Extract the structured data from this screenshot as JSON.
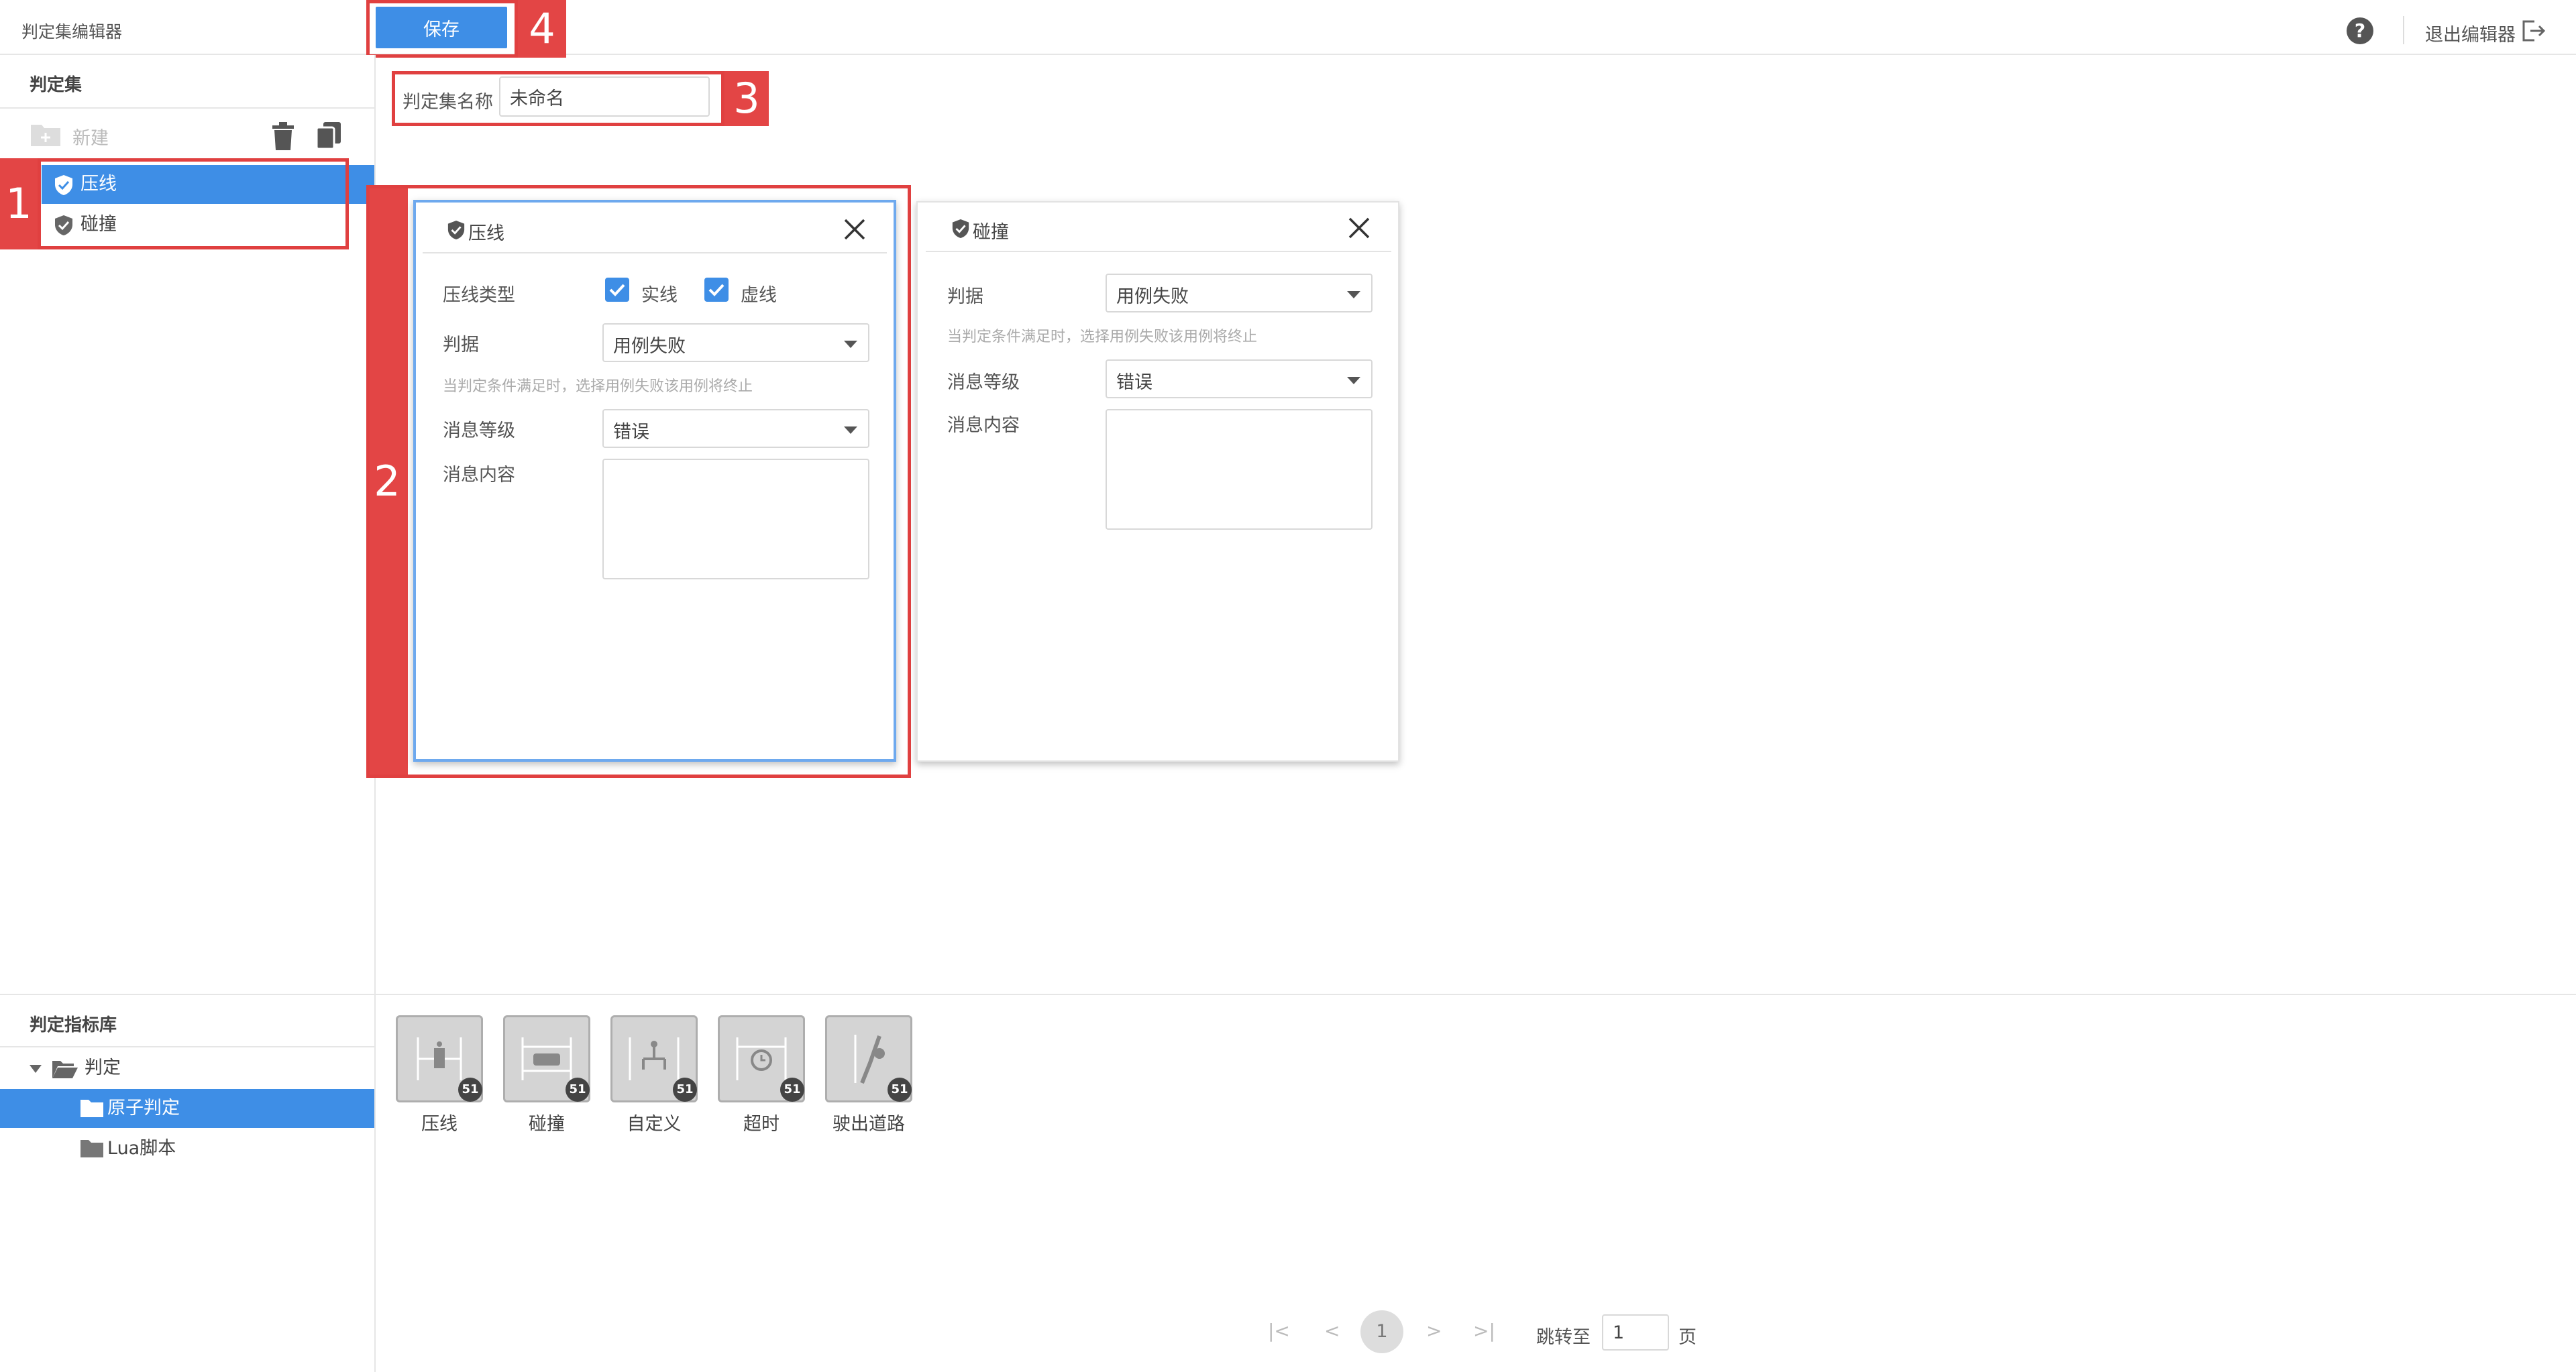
{
  "app": {
    "title": "判定集编辑器",
    "save_label": "保存",
    "help_icon": "?",
    "exit_label": "退出编辑器",
    "accent_color": "#3e8ee6",
    "marker_color": "#e34545"
  },
  "sidebar": {
    "section_title": "判定集",
    "new_label": "新建",
    "items": [
      {
        "label": "压线",
        "selected": true
      },
      {
        "label": "碰撞",
        "selected": false
      }
    ],
    "library_title": "判定指标库",
    "library_tree": [
      {
        "label": "判定",
        "expanded": true
      },
      {
        "label": "原子判定",
        "selected": true
      },
      {
        "label": "Lua脚本",
        "selected": false
      }
    ]
  },
  "form": {
    "name_label": "判定集名称",
    "name_value": "未命名"
  },
  "cards": [
    {
      "title": "压线",
      "line_type_label": "压线类型",
      "checkbox_solid": {
        "label": "实线",
        "checked": true
      },
      "checkbox_dashed": {
        "label": "虚线",
        "checked": true
      },
      "judge_label": "判据",
      "judge_value": "用例失败",
      "hint": "当判定条件满足时，选择用例失败该用例将终止",
      "level_label": "消息等级",
      "level_value": "错误",
      "content_label": "消息内容"
    },
    {
      "title": "碰撞",
      "judge_label": "判据",
      "judge_value": "用例失败",
      "hint": "当判定条件满足时，选择用例失败该用例将终止",
      "level_label": "消息等级",
      "level_value": "错误",
      "content_label": "消息内容"
    }
  ],
  "library_tiles": [
    {
      "label": "压线",
      "badge": "51",
      "icon": "line-press-icon"
    },
    {
      "label": "碰撞",
      "badge": "51",
      "icon": "collision-icon"
    },
    {
      "label": "自定义",
      "badge": "51",
      "icon": "custom-icon"
    },
    {
      "label": "超时",
      "badge": "51",
      "icon": "timeout-icon"
    },
    {
      "label": "驶出道路",
      "badge": "51",
      "icon": "off-road-icon"
    }
  ],
  "pagination": {
    "current_page": "1",
    "jump_label": "跳转至",
    "jump_value": "1",
    "page_suffix": "页"
  },
  "markers": [
    "1",
    "2",
    "3",
    "4"
  ]
}
